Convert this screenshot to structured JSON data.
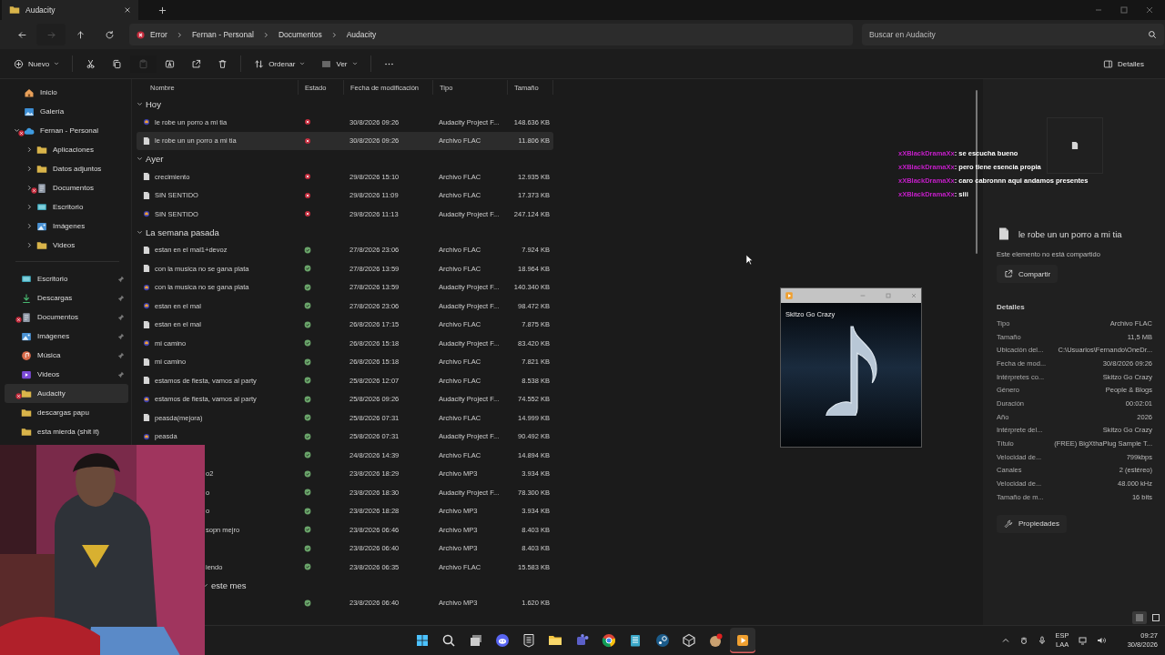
{
  "tab": {
    "title": "Audacity"
  },
  "nav": [
    {
      "kind": "back",
      "disabled": false
    },
    {
      "kind": "forward",
      "disabled": true
    },
    {
      "kind": "up",
      "disabled": false
    },
    {
      "kind": "refresh",
      "disabled": false
    }
  ],
  "address": {
    "segments": [
      {
        "kind": "error",
        "label": "Error"
      },
      {
        "kind": "folder",
        "label": "Fernan - Personal"
      },
      {
        "kind": "folder",
        "label": "Documentos"
      },
      {
        "kind": "folder",
        "label": "Audacity"
      }
    ]
  },
  "search": {
    "placeholder": "Buscar en Audacity"
  },
  "toolbar": {
    "items": [
      {
        "kind": "new",
        "label": "Nuevo",
        "disabled": false
      },
      {
        "kind": "cut",
        "disabled": false
      },
      {
        "kind": "copy",
        "disabled": false
      },
      {
        "kind": "paste",
        "disabled": true
      },
      {
        "kind": "rename",
        "disabled": false
      },
      {
        "kind": "share",
        "disabled": false
      },
      {
        "kind": "delete",
        "disabled": false
      },
      {
        "kind": "sort",
        "label": "Ordenar",
        "disabled": false
      },
      {
        "kind": "view",
        "label": "Ver",
        "disabled": false
      },
      {
        "kind": "more",
        "disabled": false
      }
    ],
    "details_label": "Detalles"
  },
  "sidebar": {
    "tree": [
      {
        "label": "Inicio",
        "kind": "home",
        "error": false,
        "selected": false
      },
      {
        "label": "Galería",
        "kind": "gallery",
        "error": false,
        "selected": false
      },
      {
        "label": "Fernan - Personal",
        "kind": "cloud",
        "expanded": true,
        "error": true,
        "selected": false,
        "children": [
          {
            "label": "Aplicaciones",
            "kind": "folder",
            "expanded": false,
            "error": false,
            "selected": false
          },
          {
            "label": "Datos adjuntos",
            "kind": "folder",
            "expanded": false,
            "error": false,
            "selected": false
          },
          {
            "label": "Documentos",
            "kind": "documents",
            "expanded": false,
            "error": true,
            "selected": false
          },
          {
            "label": "Escritorio",
            "kind": "desktop",
            "expanded": false,
            "error": false,
            "selected": false
          },
          {
            "label": "Imágenes",
            "kind": "images",
            "expanded": false,
            "error": false,
            "selected": false
          },
          {
            "label": "Videos",
            "kind": "folder",
            "expanded": false,
            "error": false,
            "selected": false
          }
        ]
      }
    ],
    "quick": [
      {
        "label": "Escritorio",
        "kind": "desktop",
        "pinned": true,
        "error": false,
        "selected": false
      },
      {
        "label": "Descargas",
        "kind": "downloads",
        "pinned": true,
        "error": false,
        "selected": false
      },
      {
        "label": "Documentos",
        "kind": "documents",
        "pinned": true,
        "error": true,
        "selected": false
      },
      {
        "label": "Imágenes",
        "kind": "images",
        "pinned": true,
        "error": false,
        "selected": false
      },
      {
        "label": "Música",
        "kind": "music",
        "pinned": true,
        "error": false,
        "selected": false
      },
      {
        "label": "Videos",
        "kind": "videos",
        "pinned": true,
        "error": false,
        "selected": false
      },
      {
        "label": "Audacity",
        "kind": "folder",
        "pinned": false,
        "error": true,
        "selected": true
      },
      {
        "label": "descargas papu",
        "kind": "folder",
        "pinned": false,
        "error": false,
        "selected": false
      },
      {
        "label": "esta mierda (shit it)",
        "kind": "folder",
        "pinned": false,
        "error": false,
        "selected": false
      }
    ]
  },
  "file_list": {
    "columns": [
      "Nombre",
      "Estado",
      "Fecha de modificación",
      "Tipo",
      "Tamaño"
    ],
    "groups": [
      {
        "label": "Hoy",
        "expanded": true,
        "covered": false,
        "rows": [
          {
            "name": "le robe un porro a mi tia",
            "kind": "project",
            "sync_error": true,
            "date": "30/8/2026 09:26",
            "type": "Audacity Project F...",
            "size": "148.636 KB",
            "selected": false,
            "covered": false
          },
          {
            "name": "le robe un un porro a mi tia",
            "kind": "file",
            "sync_error": true,
            "date": "30/8/2026 09:26",
            "type": "Archivo FLAC",
            "size": "11.806 KB",
            "selected": true,
            "covered": false
          }
        ]
      },
      {
        "label": "Ayer",
        "expanded": true,
        "covered": false,
        "rows": [
          {
            "name": "crecimiento",
            "kind": "file",
            "sync_error": true,
            "date": "29/8/2026 15:10",
            "type": "Archivo FLAC",
            "size": "12.935 KB",
            "selected": false,
            "covered": false
          },
          {
            "name": "SIN SENTIDO",
            "kind": "file",
            "sync_error": true,
            "date": "29/8/2026 11:09",
            "type": "Archivo FLAC",
            "size": "17.373 KB",
            "selected": false,
            "covered": false
          },
          {
            "name": "SIN SENTIDO",
            "kind": "project",
            "sync_error": true,
            "date": "29/8/2026 11:13",
            "type": "Audacity Project F...",
            "size": "247.124 KB",
            "selected": false,
            "covered": false
          }
        ]
      },
      {
        "label": "La semana pasada",
        "expanded": true,
        "covered": false,
        "rows": [
          {
            "name": "estan en el mal1+devoz",
            "kind": "file",
            "sync_error": false,
            "date": "27/8/2026 23:06",
            "type": "Archivo FLAC",
            "size": "7.924 KB",
            "selected": false,
            "covered": false
          },
          {
            "name": "con la musica no se gana plata",
            "kind": "file",
            "sync_error": false,
            "date": "27/8/2026 13:59",
            "type": "Archivo FLAC",
            "size": "18.964 KB",
            "selected": false,
            "covered": false
          },
          {
            "name": "con la musica no se gana plata",
            "kind": "project",
            "sync_error": false,
            "date": "27/8/2026 13:59",
            "type": "Audacity Project F...",
            "size": "140.340 KB",
            "selected": false,
            "covered": false
          },
          {
            "name": "estan en el mal",
            "kind": "project",
            "sync_error": false,
            "date": "27/8/2026 23:06",
            "type": "Audacity Project F...",
            "size": "98.472 KB",
            "selected": false,
            "covered": false
          },
          {
            "name": "estan en el mal",
            "kind": "file",
            "sync_error": false,
            "date": "26/8/2026 17:15",
            "type": "Archivo FLAC",
            "size": "7.875 KB",
            "selected": false,
            "covered": false
          },
          {
            "name": "mi camino",
            "kind": "project",
            "sync_error": false,
            "date": "26/8/2026 15:18",
            "type": "Audacity Project F...",
            "size": "83.420 KB",
            "selected": false,
            "covered": false
          },
          {
            "name": "mi camino",
            "kind": "file",
            "sync_error": false,
            "date": "26/8/2026 15:18",
            "type": "Archivo FLAC",
            "size": "7.821 KB",
            "selected": false,
            "covered": false
          },
          {
            "name": "estamos de fiesta, vamos al party",
            "kind": "file",
            "sync_error": false,
            "date": "25/8/2026 12:07",
            "type": "Archivo FLAC",
            "size": "8.538 KB",
            "selected": false,
            "covered": false
          },
          {
            "name": "estamos de fiesta, vamos al party",
            "kind": "project",
            "sync_error": false,
            "date": "25/8/2026 09:26",
            "type": "Audacity Project F...",
            "size": "74.552 KB",
            "selected": false,
            "covered": false
          },
          {
            "name": "peasda(mejora)",
            "kind": "file",
            "sync_error": false,
            "date": "25/8/2026 07:31",
            "type": "Archivo FLAC",
            "size": "14.999 KB",
            "selected": false,
            "covered": false
          },
          {
            "name": "peasda",
            "kind": "project",
            "sync_error": false,
            "date": "25/8/2026 07:31",
            "type": "Audacity Project F...",
            "size": "90.492 KB",
            "selected": false,
            "covered": false
          },
          {
            "sync_error": false,
            "date": "24/8/2026 14:39",
            "type": "Archivo FLAC",
            "size": "14.894 KB",
            "selected": false,
            "covered": true
          },
          {
            "name": "o2",
            "sync_error": false,
            "date": "23/8/2026 18:29",
            "type": "Archivo MP3",
            "size": "3.934 KB",
            "selected": false,
            "covered": true
          },
          {
            "name": "o",
            "sync_error": false,
            "date": "23/8/2026 18:30",
            "type": "Audacity Project F...",
            "size": "78.300 KB",
            "selected": false,
            "covered": true
          },
          {
            "name": "o",
            "sync_error": false,
            "date": "23/8/2026 18:28",
            "type": "Archivo MP3",
            "size": "3.934 KB",
            "selected": false,
            "covered": true
          },
          {
            "name": "sopn mejro",
            "sync_error": false,
            "date": "23/8/2026 06:46",
            "type": "Archivo MP3",
            "size": "8.403 KB",
            "selected": false,
            "covered": true
          },
          {
            "sync_error": false,
            "date": "23/8/2026 06:40",
            "type": "Archivo MP3",
            "size": "8.403 KB",
            "selected": false,
            "covered": true
          },
          {
            "name": "iendo",
            "sync_error": false,
            "date": "23/8/2026 06:35",
            "type": "Archivo FLAC",
            "size": "15.583 KB",
            "selected": false,
            "covered": true
          }
        ]
      },
      {
        "label": "este mes",
        "expanded": true,
        "covered": true,
        "rows": [
          {
            "sync_error": false,
            "date": "23/8/2026 06:40",
            "type": "Archivo MP3",
            "size": "1.620 KB",
            "selected": false,
            "covered": true
          }
        ]
      }
    ]
  },
  "details": {
    "title": "le robe un un porro a mi tia",
    "sharing": "Este elemento no está compartido",
    "share_button": "Compartir",
    "section": "Detalles",
    "properties": [
      {
        "label": "Tipo",
        "value": "Archivo FLAC"
      },
      {
        "label": "Tamaño",
        "value": "11,5 MB"
      },
      {
        "label": "Ubicación del...",
        "value": "C:\\Usuarios\\Fernando\\OneDr..."
      },
      {
        "label": "Fecha de mod...",
        "value": "30/8/2026 09:26"
      },
      {
        "label": "Intérpretes co...",
        "value": "Skitzo Go Crazy"
      },
      {
        "label": "Género",
        "value": "People & Blogs"
      },
      {
        "label": "Duración",
        "value": "00:02:01"
      },
      {
        "label": "Año",
        "value": "2026"
      },
      {
        "label": "Intérprete del...",
        "value": "Skitzo Go Crazy"
      },
      {
        "label": "Título",
        "value": "(FREE) BigXthaPlug Sample T..."
      },
      {
        "label": "Velocidad de...",
        "value": "799kbps"
      },
      {
        "label": "Canales",
        "value": "2 (estéreo)"
      },
      {
        "label": "Velocidad de...",
        "value": "48.000 kHz"
      },
      {
        "label": "Tamaño de m...",
        "value": "16 bits"
      }
    ],
    "properties_button": "Propiedades",
    "view_modes": [
      {
        "kind": "details",
        "selected": true
      },
      {
        "kind": "tiles",
        "selected": false
      }
    ]
  },
  "chat": [
    {
      "user": "xXBlackDramaXx",
      "text": ": se escucha bueno"
    },
    {
      "user": "xXBlackDramaXx",
      "text": ": pero tiene esencia propia"
    },
    {
      "user": "xXBlackDramaXx",
      "text": ": caro cabronnn aqui andamos presentes"
    },
    {
      "user": "xXBlackDramaXx",
      "text": ": siii"
    }
  ],
  "player": {
    "title": "Skitzo Go Crazy"
  },
  "taskbar": {
    "apps": [
      {
        "kind": "start",
        "active": false
      },
      {
        "kind": "search",
        "active": false
      },
      {
        "kind": "taskview",
        "active": false
      },
      {
        "kind": "chat",
        "active": false
      },
      {
        "kind": "store",
        "active": false
      },
      {
        "kind": "explorer",
        "active": false
      },
      {
        "kind": "people",
        "active": false
      },
      {
        "kind": "browser",
        "active": false
      },
      {
        "kind": "notepad",
        "active": false
      },
      {
        "kind": "launcher",
        "active": false
      },
      {
        "kind": "cube",
        "active": false
      },
      {
        "kind": "badge",
        "active": false
      },
      {
        "kind": "player",
        "active": true
      }
    ],
    "language": "ESP",
    "layout": "LAA",
    "time": "09:27",
    "date": "30/8/2026"
  }
}
